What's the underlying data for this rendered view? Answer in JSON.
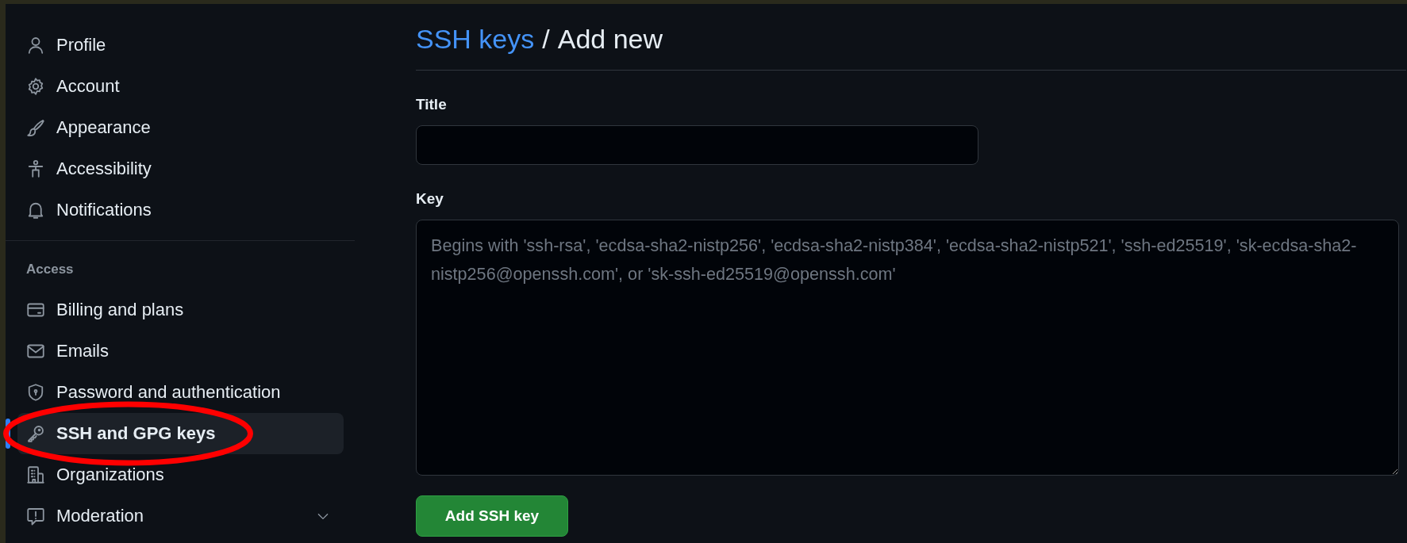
{
  "sidebar": {
    "items": [
      {
        "label": "Profile",
        "selected": false,
        "circled": false
      },
      {
        "label": "Account",
        "selected": false,
        "circled": false
      },
      {
        "label": "Appearance",
        "selected": false,
        "circled": false
      },
      {
        "label": "Accessibility",
        "selected": false,
        "circled": false
      },
      {
        "label": "Notifications",
        "selected": false,
        "circled": false
      }
    ],
    "sections": [
      {
        "heading": "Access",
        "items": [
          {
            "label": "Billing and plans",
            "selected": false,
            "circled": false
          },
          {
            "label": "Emails",
            "selected": false,
            "circled": false
          },
          {
            "label": "Password and authentication",
            "selected": false,
            "circled": false
          },
          {
            "label": "SSH and GPG keys",
            "selected": true,
            "circled": true
          },
          {
            "label": "Organizations",
            "selected": false,
            "circled": false
          },
          {
            "label": "Moderation",
            "expanded": false,
            "selected": false,
            "circled": false
          }
        ]
      }
    ]
  },
  "breadcrumb": {
    "link": "SSH keys",
    "separator": "/",
    "current": "Add new"
  },
  "form": {
    "fields": [
      {
        "label": "Title",
        "kind": "input"
      },
      {
        "label": "Key",
        "kind": "textarea",
        "placeholder": "Begins with 'ssh-rsa', 'ecdsa-sha2-nistp256', 'ecdsa-sha2-nistp384', 'ecdsa-sha2-nistp521', 'ssh-ed25519', 'sk-ecdsa-sha2-nistp256@openssh.com', or 'sk-ssh-ed25519@openssh.com'"
      }
    ],
    "submit": "Add SSH key"
  }
}
